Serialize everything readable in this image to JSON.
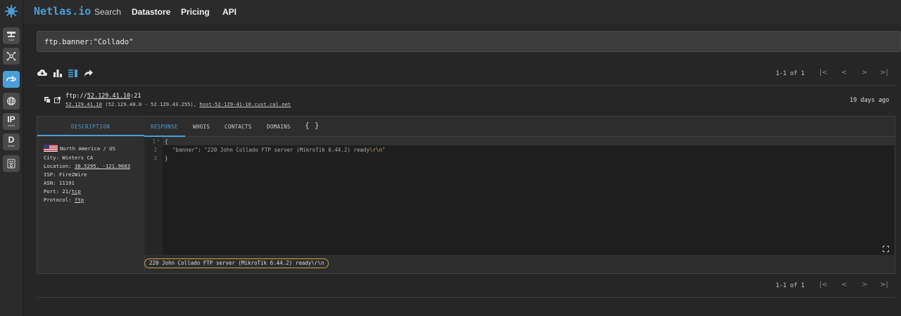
{
  "app": {
    "brand": "Netlas.io"
  },
  "nav": {
    "search": "Search",
    "datastore": "Datastore",
    "pricing": "Pricing",
    "api": "API"
  },
  "sidebar": {
    "host_label": "host",
    "ip_label": "IP",
    "ip_sub": "whois",
    "d_label": "D",
    "d_sub": "whois"
  },
  "search": {
    "query": "ftp.banner:\"Collado\""
  },
  "pagination": {
    "range_top": "1-1 of 1",
    "range_bottom": "1-1 of 1"
  },
  "result": {
    "url_prefix": "ftp://",
    "url_ip": "52.129.41.10",
    "url_port": ":21",
    "ip": "52.129.41.10",
    "range": " (52.129.40.0 - 52.129.43.255), ",
    "hostname": "host-52-129-41-10.cust.cal.net",
    "age": "19 days ago"
  },
  "tabs": {
    "description": "DESCRIPTION",
    "response": "RESPONSE",
    "whois": "WHOIS",
    "contacts": "CONTACTS",
    "domains": "DOMAINS",
    "json": "{ }"
  },
  "info": {
    "region": "North America / US",
    "city": "City: Winters CA",
    "location_label": "Location: ",
    "location_value": "38.5295, -121.9683",
    "isp": "ISP: Fire2Wire",
    "asn": "ASN: 11191",
    "port_label": "Port: 21/",
    "port_proto": "tcp",
    "protocol_label": "Protocol: ",
    "protocol_value": "ftp"
  },
  "code": {
    "lines": [
      "1",
      "2",
      "3"
    ],
    "open": "{",
    "key": "\"banner\"",
    "colon": ": ",
    "value": "\"220 John Collado FTP server (MikroTik 6.44.2) ready",
    "escape": "\\r\\n",
    "value_end": "\"",
    "close": "}"
  },
  "highlight": {
    "text": "220 John Collado FTP server (MikroTik 6.44.2) ready\\r\\n"
  },
  "colors": {
    "accent": "#4a9fd8",
    "highlight_border": "#c8a24a",
    "escape": "#d6a85a"
  }
}
